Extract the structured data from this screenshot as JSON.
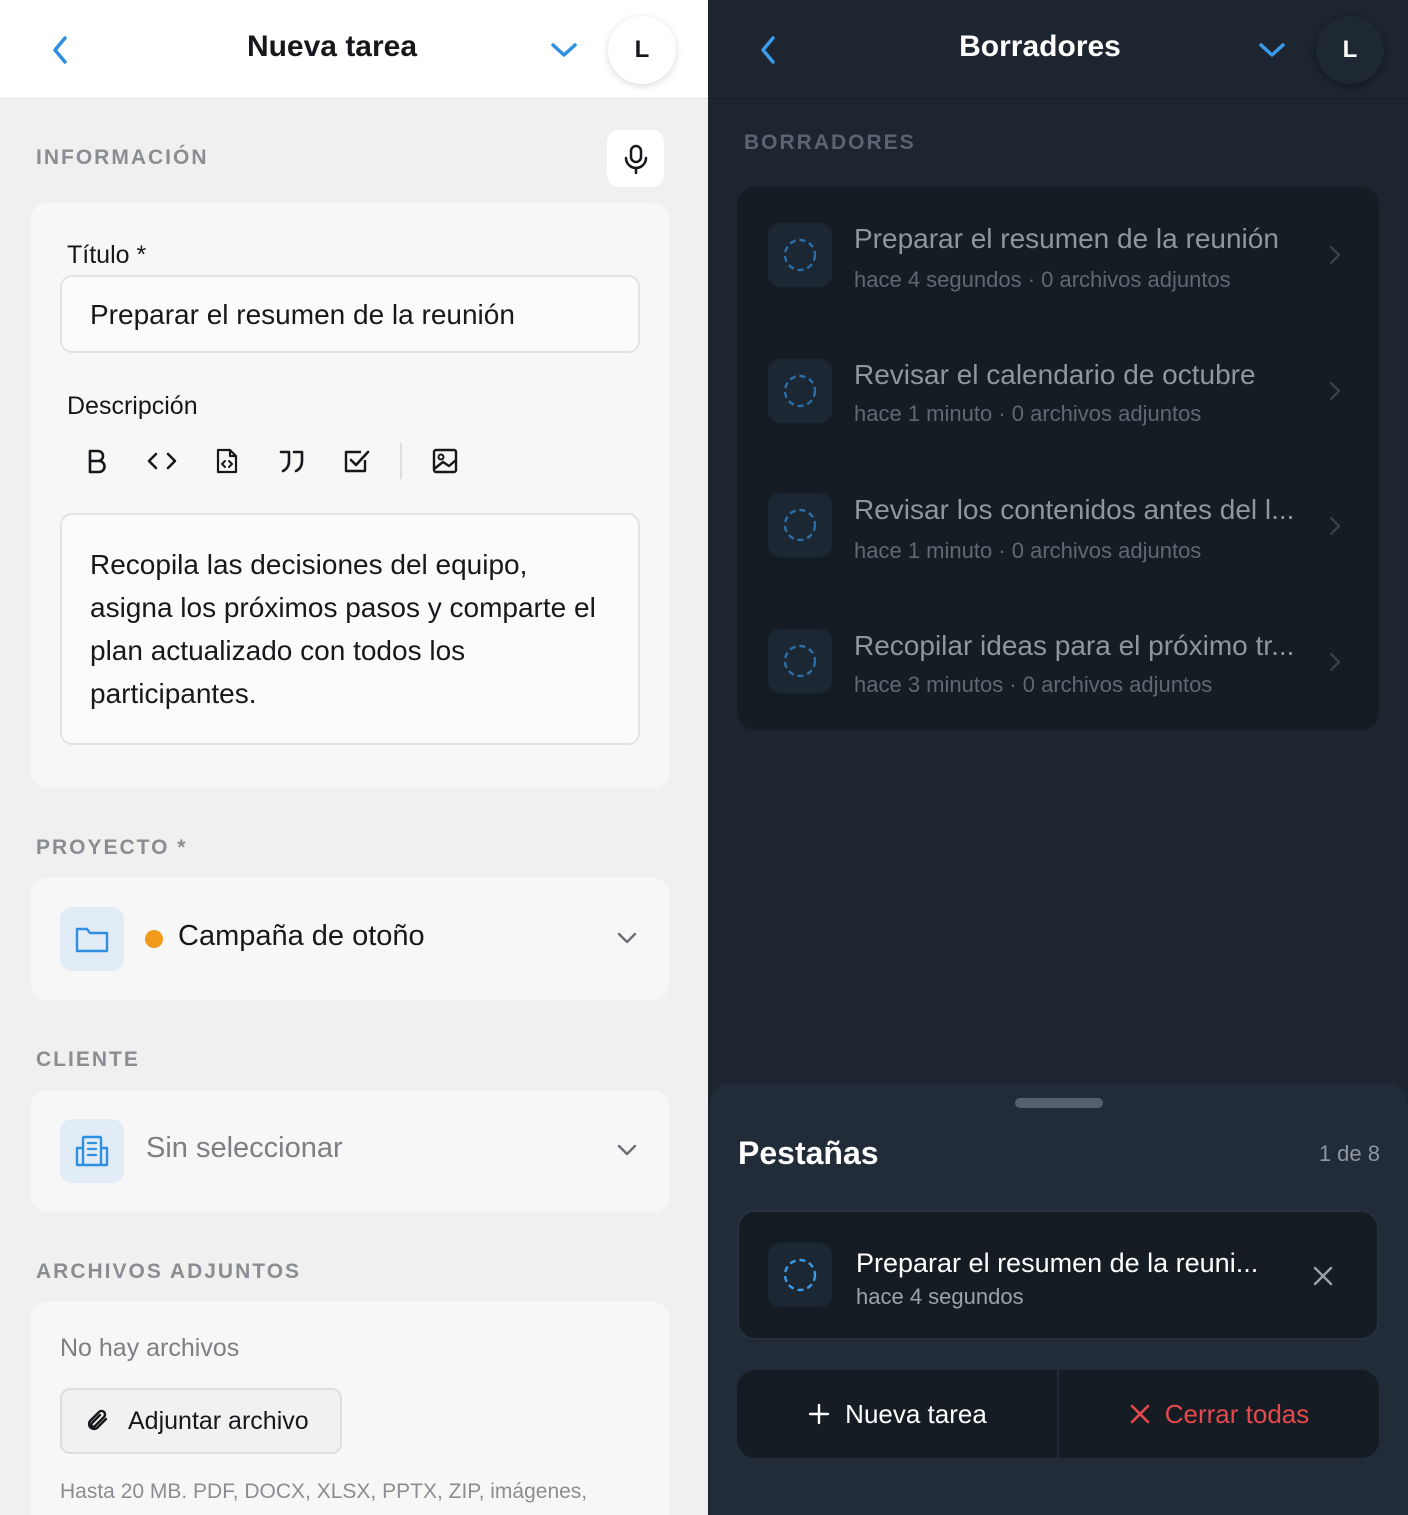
{
  "left": {
    "header": {
      "title": "Nueva tarea",
      "avatar_initial": "L"
    },
    "info_section": {
      "label": "INFORMACIÓN",
      "title_label": "Título *",
      "title_value": "Preparar el resumen de la reunión",
      "description_label": "Descripción",
      "toolbar": [
        "bold",
        "code-inline",
        "code-file",
        "quote",
        "checklist",
        "image"
      ],
      "description_value": "Recopila las decisiones del equipo, asigna los próximos pasos y comparte el plan actualizado con todos los participantes."
    },
    "project_section": {
      "label": "PROYECTO *",
      "selected": "Campaña de otoño",
      "dot_color": "#f29a1b"
    },
    "client_section": {
      "label": "CLIENTE",
      "placeholder": "Sin seleccionar"
    },
    "attachments_section": {
      "label": "ARCHIVOS ADJUNTOS",
      "empty_text": "No hay archivos",
      "attach_button": "Adjuntar archivo",
      "hint": "Hasta 20 MB. PDF, DOCX, XLSX, PPTX, ZIP, imágenes,"
    }
  },
  "right": {
    "header": {
      "title": "Borradores",
      "avatar_initial": "L"
    },
    "section_label": "BORRADORES",
    "drafts": [
      {
        "title": "Preparar el resumen de la reunión",
        "subtitle": "hace 4 segundos · 0 archivos adjuntos"
      },
      {
        "title": "Revisar el calendario de octubre",
        "subtitle": "hace 1 minuto · 0 archivos adjuntos"
      },
      {
        "title": "Revisar los contenidos antes del l...",
        "subtitle": "hace 1 minuto · 0 archivos adjuntos"
      },
      {
        "title": "Recopilar ideas para el próximo tr...",
        "subtitle": "hace 3 minutos · 0 archivos adjuntos"
      }
    ],
    "sheet": {
      "title": "Pestañas",
      "count": "1 de 8",
      "tab": {
        "title": "Preparar el resumen de la reuni...",
        "subtitle": "hace 4 segundos"
      },
      "new_task": "Nueva tarea",
      "close_all": "Cerrar todas"
    }
  },
  "colors": {
    "accent_blue": "#2f8fe0",
    "danger_red": "#e5484d",
    "project_dot": "#f29a1b"
  }
}
